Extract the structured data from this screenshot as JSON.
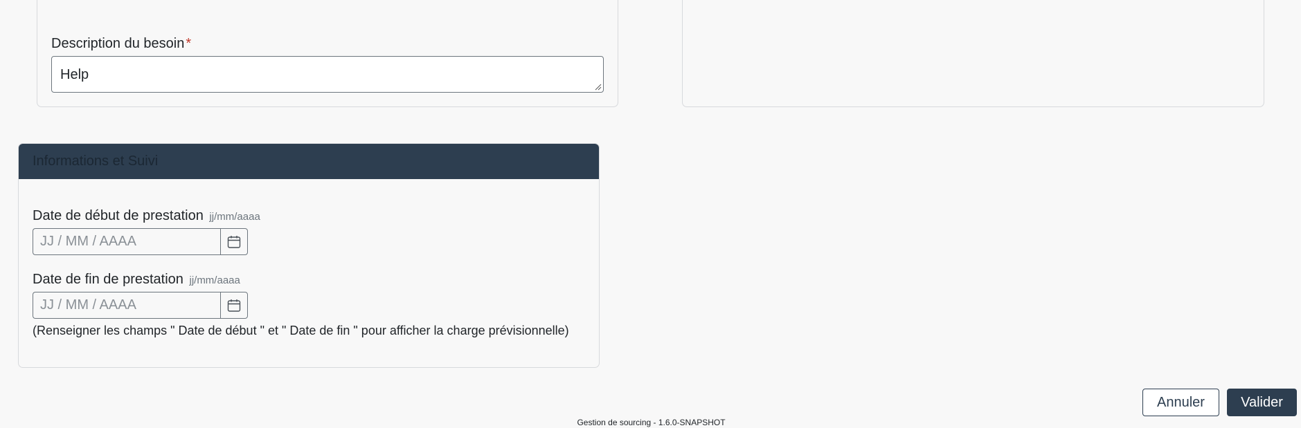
{
  "description": {
    "label": "Description du besoin",
    "required_marker": "*",
    "value": "Help"
  },
  "info_section": {
    "title": "Informations et Suivi",
    "start_date": {
      "label": "Date de début de prestation",
      "hint": "jj/mm/aaaa",
      "placeholder": "JJ / MM / AAAA",
      "icon": "calendar-icon"
    },
    "end_date": {
      "label": "Date de fin de prestation",
      "hint": "jj/mm/aaaa",
      "placeholder": "JJ / MM / AAAA",
      "icon": "calendar-icon"
    },
    "help_text": "(Renseigner les champs \" Date de début \" et \" Date de fin \" pour afficher la charge prévisionnelle)"
  },
  "actions": {
    "cancel_label": "Annuler",
    "submit_label": "Valider"
  },
  "footer": {
    "text": "Gestion de sourcing - 1.6.0-SNAPSHOT"
  },
  "colors": {
    "primary": "#2d3e50",
    "background": "#f8f8f8",
    "required": "#c0392b"
  }
}
